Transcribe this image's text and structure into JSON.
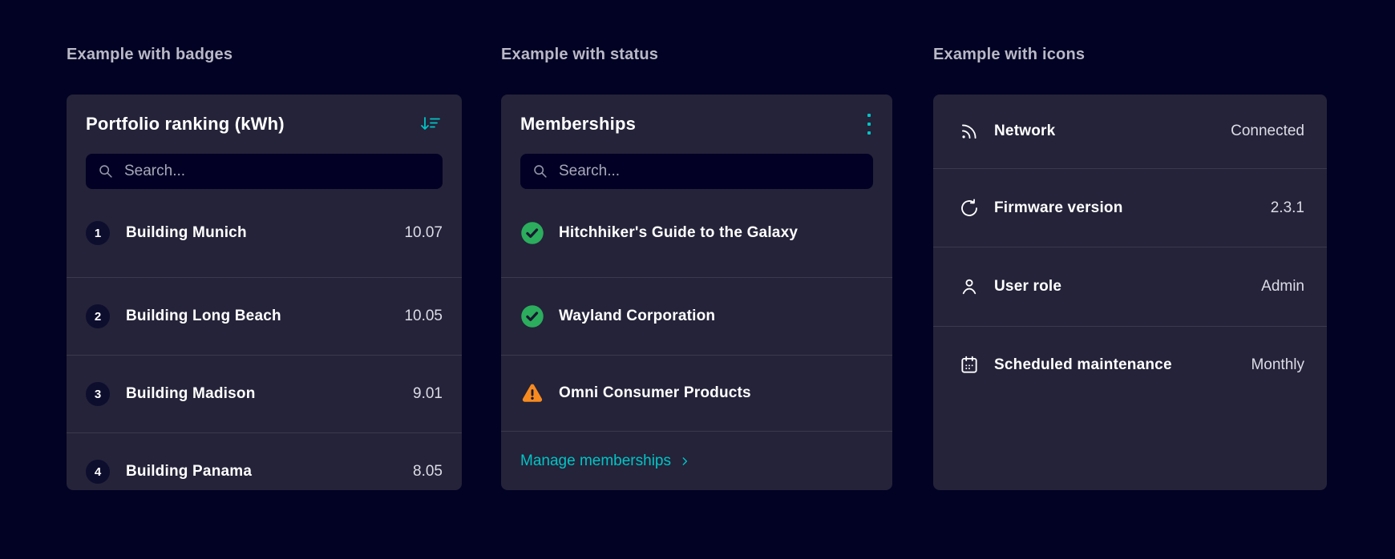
{
  "colors": {
    "accent": "#00c5c5",
    "success": "#2bad5d",
    "warning": "#f78a1f",
    "page_background": "#020224",
    "card_background": "#242339"
  },
  "sections": [
    {
      "heading": "Example with badges",
      "card": {
        "title": "Portfolio ranking (kWh)",
        "sort_icon": "sort-descending-icon",
        "search_placeholder": "Search...",
        "rows": [
          {
            "rank": "1",
            "name": "Building Munich",
            "value": "10.07"
          },
          {
            "rank": "2",
            "name": "Building Long Beach",
            "value": "10.05"
          },
          {
            "rank": "3",
            "name": "Building Madison",
            "value": "9.01"
          },
          {
            "rank": "4",
            "name": "Building Panama",
            "value": "8.05"
          }
        ]
      }
    },
    {
      "heading": "Example with status",
      "card": {
        "title": "Memberships",
        "menu_icon": "kebab-menu-icon",
        "search_placeholder": "Search...",
        "rows": [
          {
            "status": "success",
            "name": "Hitchhiker's Guide to the Galaxy"
          },
          {
            "status": "success",
            "name": "Wayland Corporation"
          },
          {
            "status": "warning",
            "name": "Omni Consumer Products"
          }
        ],
        "footer_link": "Manage memberships"
      }
    },
    {
      "heading": "Example with icons",
      "card": {
        "rows": [
          {
            "icon": "network",
            "label": "Network",
            "value": "Connected"
          },
          {
            "icon": "firmware",
            "label": "Firmware version",
            "value": "2.3.1"
          },
          {
            "icon": "user",
            "label": "User role",
            "value": "Admin"
          },
          {
            "icon": "calendar",
            "label": "Scheduled maintenance",
            "value": "Monthly"
          }
        ]
      }
    }
  ]
}
